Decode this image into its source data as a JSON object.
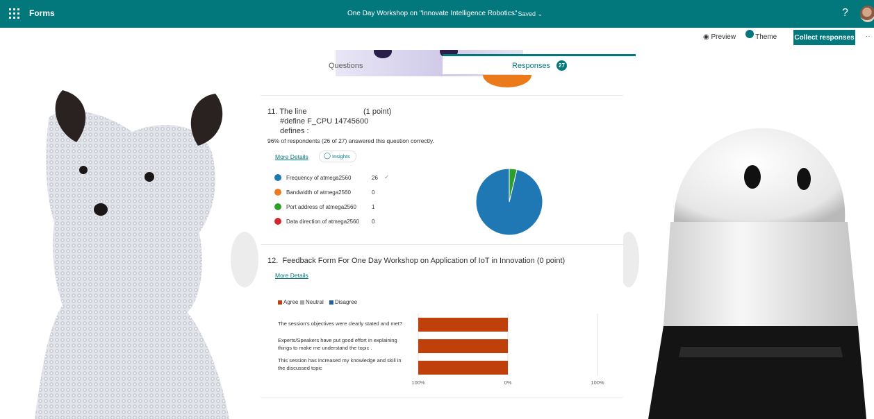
{
  "app": {
    "name": "Forms",
    "form_title": "One Day Workshop on \"Innovate Intelligence Robotics\"",
    "saved_status": "- Saved",
    "help_label": "?"
  },
  "commands": {
    "preview_label": "Preview",
    "theme_label": "Theme",
    "collect_label": "Collect responses",
    "more_label": "··"
  },
  "tabs": {
    "questions_label": "Questions",
    "responses_label": "Responses",
    "responses_count": "27"
  },
  "q11": {
    "title": "11. The line",
    "points": "(1 point)",
    "code_line": "#define F_CPU 14745600",
    "defines": "defines :",
    "summary": "96% of respondents (26 of 27) answered this question correctly.",
    "more_details": "More Details",
    "insights": "Insights",
    "options": [
      {
        "label": "Frequency of atmega2560",
        "count": "26",
        "correct_mark": "✓",
        "color": "#1f77b4"
      },
      {
        "label": "Bandwidth of atmega2560",
        "count": "0",
        "correct_mark": "",
        "color": "#ee7d21"
      },
      {
        "label": "Port address of atmega2560",
        "count": "1",
        "correct_mark": "",
        "color": "#2ca02c"
      },
      {
        "label": "Data direction of atmega2560",
        "count": "0",
        "correct_mark": "",
        "color": "#d62728"
      }
    ]
  },
  "q12": {
    "title": "12.  Feedback Form For One Day Workshop on Application of IoT in Innovation (0 point)",
    "more_details": "More Details",
    "legend": [
      {
        "label": "Agree",
        "color": "#c0400c"
      },
      {
        "label": "Neutral",
        "color": "#a6a6a6"
      },
      {
        "label": "Disagree",
        "color": "#1f5fa0"
      }
    ],
    "statements": [
      {
        "line1": "The session's objectives were clearly stated and met?",
        "line2": ""
      },
      {
        "line1": "Experts/Speakers have put good effort in explaining",
        "line2": "things to make me understand the topic ."
      },
      {
        "line1": "This session has increased my knowledge and skill in",
        "line2": "the discussed topic"
      }
    ],
    "axis_ticks": [
      "100%",
      "0%",
      "100%"
    ]
  },
  "chart_data": [
    {
      "type": "pie",
      "categories": [
        "Frequency of atmega2560",
        "Bandwidth of atmega2560",
        "Port address of atmega2560",
        "Data direction of atmega2560"
      ],
      "values": [
        26,
        0,
        1,
        0
      ],
      "colors": [
        "#1f77b4",
        "#ee7d21",
        "#2ca02c",
        "#d62728"
      ]
    },
    {
      "type": "bar",
      "orientation": "horizontal-diverging",
      "categories": [
        "The session's objectives were clearly stated and met?",
        "Experts/Speakers have put good effort in explaining things to make me understand the topic .",
        "This session has increased my knowledge and skill in the discussed topic"
      ],
      "series": [
        {
          "name": "Agree",
          "values": [
            100,
            100,
            100
          ]
        },
        {
          "name": "Neutral",
          "values": [
            0,
            0,
            0
          ]
        },
        {
          "name": "Disagree",
          "values": [
            0,
            0,
            0
          ]
        }
      ],
      "xlim": [
        -100,
        100
      ],
      "tick_labels": [
        "100%",
        "0%",
        "100%"
      ],
      "legend_position": "top-left"
    }
  ]
}
